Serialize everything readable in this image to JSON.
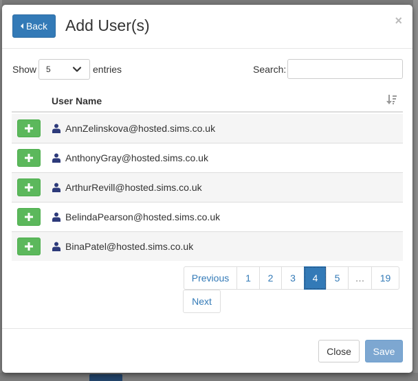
{
  "header": {
    "back_label": "Back",
    "title": "Add User(s)",
    "close_glyph": "×"
  },
  "controls": {
    "show_label": "Show",
    "entries_value": "5",
    "entries_label": "entries",
    "search_label": "Search:",
    "search_value": ""
  },
  "table": {
    "column_user": "User Name",
    "rows": [
      {
        "user": "AnnZelinskova@hosted.sims.co.uk"
      },
      {
        "user": "AnthonyGray@hosted.sims.co.uk"
      },
      {
        "user": "ArthurRevill@hosted.sims.co.uk"
      },
      {
        "user": "BelindaPearson@hosted.sims.co.uk"
      },
      {
        "user": "BinaPatel@hosted.sims.co.uk"
      }
    ]
  },
  "pagination": {
    "previous": "Previous",
    "pages": [
      "1",
      "2",
      "3",
      "4",
      "5",
      "…",
      "19"
    ],
    "active_page": "4",
    "next": "Next"
  },
  "footer": {
    "close_label": "Close",
    "save_label": "Save"
  },
  "colors": {
    "primary": "#337ab7",
    "success": "#5cb85c",
    "save_disabled": "#7da7d1",
    "user_icon": "#2d3a7a"
  },
  "icons": {
    "back": "caret-left-icon",
    "close": "close-icon",
    "select": "chevron-down-icon",
    "sort": "sort-descending-icon",
    "add": "plus-icon",
    "user": "user-icon"
  }
}
